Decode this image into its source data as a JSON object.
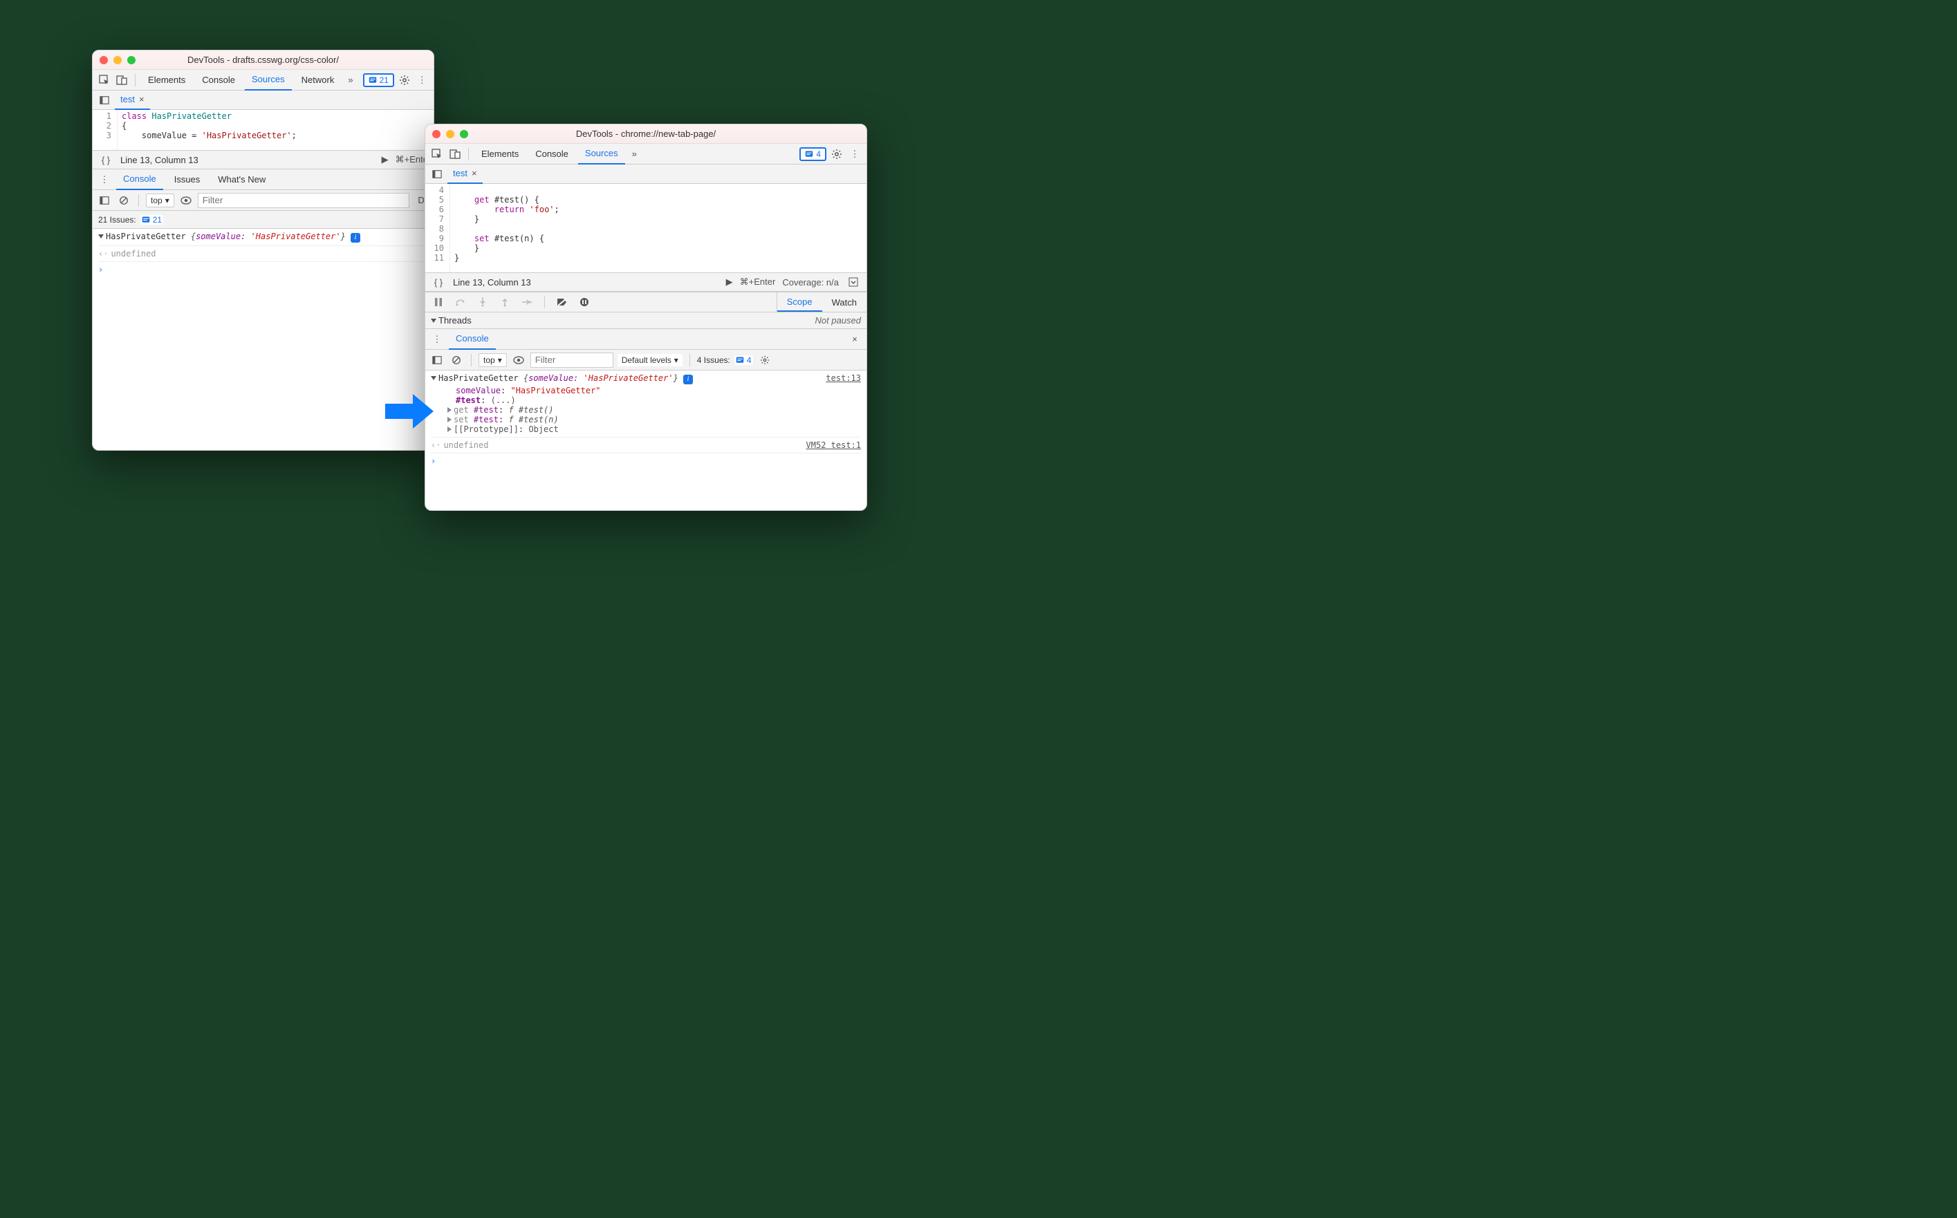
{
  "left": {
    "title": "DevTools - drafts.csswg.org/css-color/",
    "tabs": [
      "Elements",
      "Console",
      "Sources",
      "Network"
    ],
    "active_tab": "Sources",
    "issues_badge": "21",
    "file_tab": "test",
    "code_lines": [
      "1",
      "2",
      "3"
    ],
    "code_tokens": {
      "l1_kw": "class",
      "l1_cls": "HasPrivateGetter",
      "l2": "{",
      "l3_prop": "someValue = ",
      "l3_str": "'HasPrivateGetter'",
      "l3_end": ";"
    },
    "status_left": "Line 13, Column 13",
    "status_right": "⌘+Ente",
    "drawer_tabs": [
      "Console",
      "Issues",
      "What's New"
    ],
    "drawer_active": "Console",
    "ctx": "top",
    "filter_placeholder": "Filter",
    "levels_cut": "De",
    "issues_bar_label": "21 Issues:",
    "issues_bar_count": "21",
    "console": {
      "class": "HasPrivateGetter",
      "preview_prop": "someValue:",
      "preview_val": "'HasPrivateGetter'",
      "undef": "undefined"
    }
  },
  "right": {
    "title": "DevTools - chrome://new-tab-page/",
    "tabs": [
      "Elements",
      "Console",
      "Sources"
    ],
    "active_tab": "Sources",
    "issues_badge": "4",
    "file_tab": "test",
    "code_lines": [
      "4",
      "5",
      "6",
      "7",
      "8",
      "9",
      "10",
      "11"
    ],
    "code": {
      "l5a": "get",
      "l5b": " #test() {",
      "l6a": "return",
      "l6b": "'foo'",
      "l6c": ";",
      "l7": "}",
      "l9a": "set",
      "l9b": " #test(n) {",
      "l10": "}",
      "l11": "}"
    },
    "status_left": "Line 13, Column 13",
    "status_mid": "⌘+Enter",
    "status_cov": "Coverage: n/a",
    "scope": "Scope",
    "watch": "Watch",
    "threads": "Threads",
    "notpaused": "Not paused",
    "drawer_active": "Console",
    "ctx": "top",
    "filter_placeholder": "Filter",
    "levels": "Default levels",
    "issues_bar_label": "4 Issues:",
    "issues_bar_count": "4",
    "console": {
      "class": "HasPrivateGetter",
      "preview_prop": "someValue:",
      "preview_val": "'HasPrivateGetter'",
      "loc1": "test:13",
      "p1_key": "someValue",
      "p1_val": "\"HasPrivateGetter\"",
      "p2_key": "#test",
      "p2_val": "(...)",
      "p3_pre": "get ",
      "p3_key": "#test",
      "p3_val": "f #test()",
      "p4_pre": "set ",
      "p4_key": "#test",
      "p4_val": "f #test(n)",
      "p5_key": "[[Prototype]]",
      "p5_val": "Object",
      "undef": "undefined",
      "loc2": "VM52 test:1"
    }
  }
}
